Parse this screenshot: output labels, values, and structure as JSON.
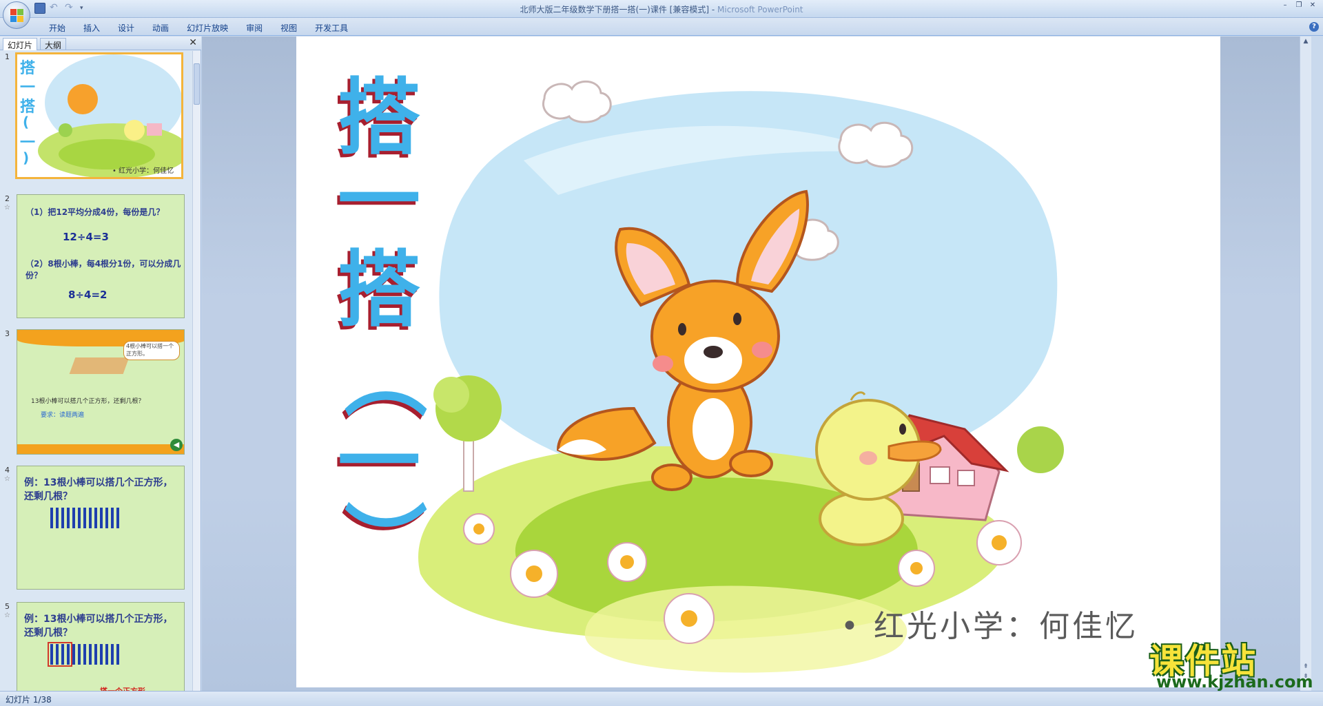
{
  "window": {
    "title": "北师大版二年级数学下册搭一搭(一)课件 [兼容模式] - ",
    "app_name": "Microsoft PowerPoint",
    "controls": [
      "–",
      "❐",
      "✕"
    ]
  },
  "ribbon": {
    "tabs": [
      "开始",
      "插入",
      "设计",
      "动画",
      "幻灯片放映",
      "审阅",
      "视图",
      "开发工具"
    ],
    "help": "?"
  },
  "left_pane": {
    "tabs": [
      "幻灯片",
      "大纲"
    ],
    "close": "✕",
    "slides": [
      {
        "num": "1",
        "title_chars": [
          "搭",
          "一",
          "搭",
          "(",
          "一",
          ")"
        ],
        "byline": "• 红光小学：何佳忆"
      },
      {
        "num": "2",
        "line1": "（1）把12平均分成4份，每份是几？",
        "eq1": "12÷4=3",
        "line2": "（2）8根小棒，每4根分1份，可以分成几份？",
        "eq2": "8÷4=2"
      },
      {
        "num": "3",
        "bubble": "4根小棒可以搭一个正方形。",
        "question": "13根小棒可以搭几个正方形，还剩几根？",
        "req": "要求：读题两遍"
      },
      {
        "num": "4",
        "text": "例：13根小棒可以搭几个正方形，还剩几根？"
      },
      {
        "num": "5",
        "text": "例：13根小棒可以搭几个正方形，还剩几根？",
        "caption": "搭一个正方形"
      }
    ]
  },
  "slide": {
    "title_chars": [
      "搭",
      "一",
      "搭",
      "︵",
      "一",
      "︶"
    ],
    "byline": "• 红光小学：何佳忆"
  },
  "watermark": {
    "big": "课件站",
    "small": "www.kjzhan.com"
  },
  "status": {
    "text": "幻灯片 1/38"
  },
  "colors": {
    "title_blue": "#3fb1ea",
    "title_shadow": "#a71f2f",
    "thumb_bg": "#d6efb8",
    "selected_border": "#f4b43b"
  }
}
